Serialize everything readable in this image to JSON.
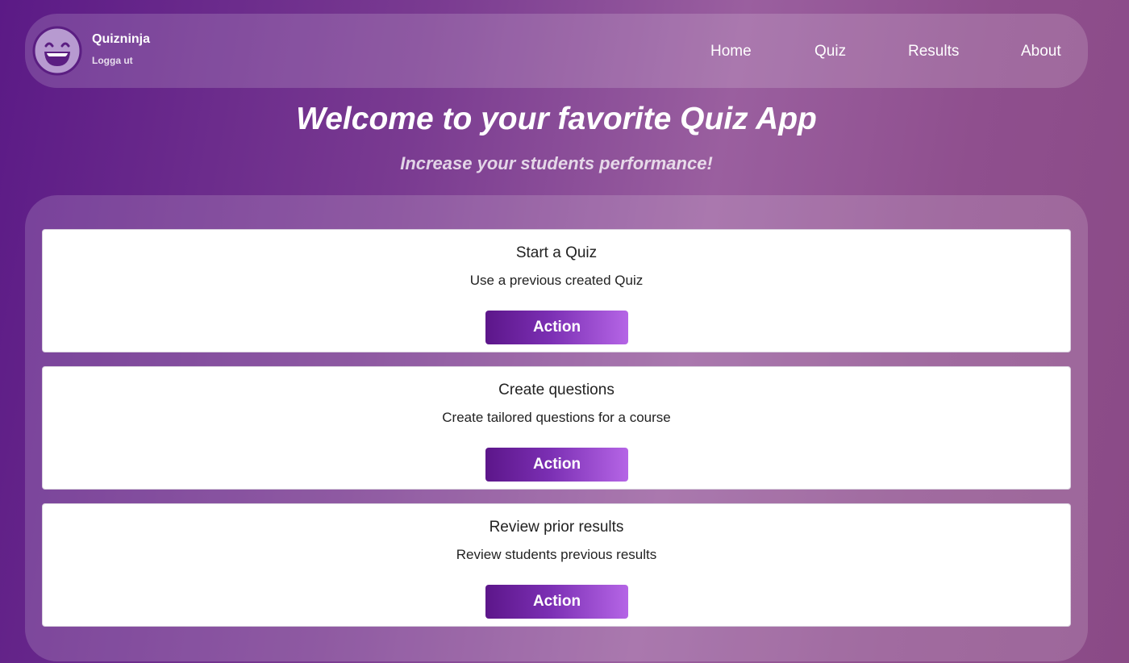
{
  "header": {
    "brand_name": "Quizninja",
    "logout_label": "Logga ut",
    "nav": [
      {
        "label": "Home"
      },
      {
        "label": "Quiz"
      },
      {
        "label": "Results"
      },
      {
        "label": "About"
      }
    ],
    "avatar_icon": "laughing-face-icon"
  },
  "hero": {
    "title": "Welcome to your favorite Quiz App",
    "subtitle": "Increase your students performance!"
  },
  "cards": [
    {
      "title": "Start a Quiz",
      "text": "Use a previous created Quiz",
      "button_label": "Action"
    },
    {
      "title": "Create questions",
      "text": "Create tailored questions for a course",
      "button_label": "Action"
    },
    {
      "title": "Review prior results",
      "text": "Review students previous results",
      "button_label": "Action"
    }
  ],
  "colors": {
    "background_start": "#5b1a86",
    "background_end": "#8a4a86",
    "button_start": "#5c168a",
    "button_end": "#b565e6",
    "card_background": "#ffffff"
  }
}
